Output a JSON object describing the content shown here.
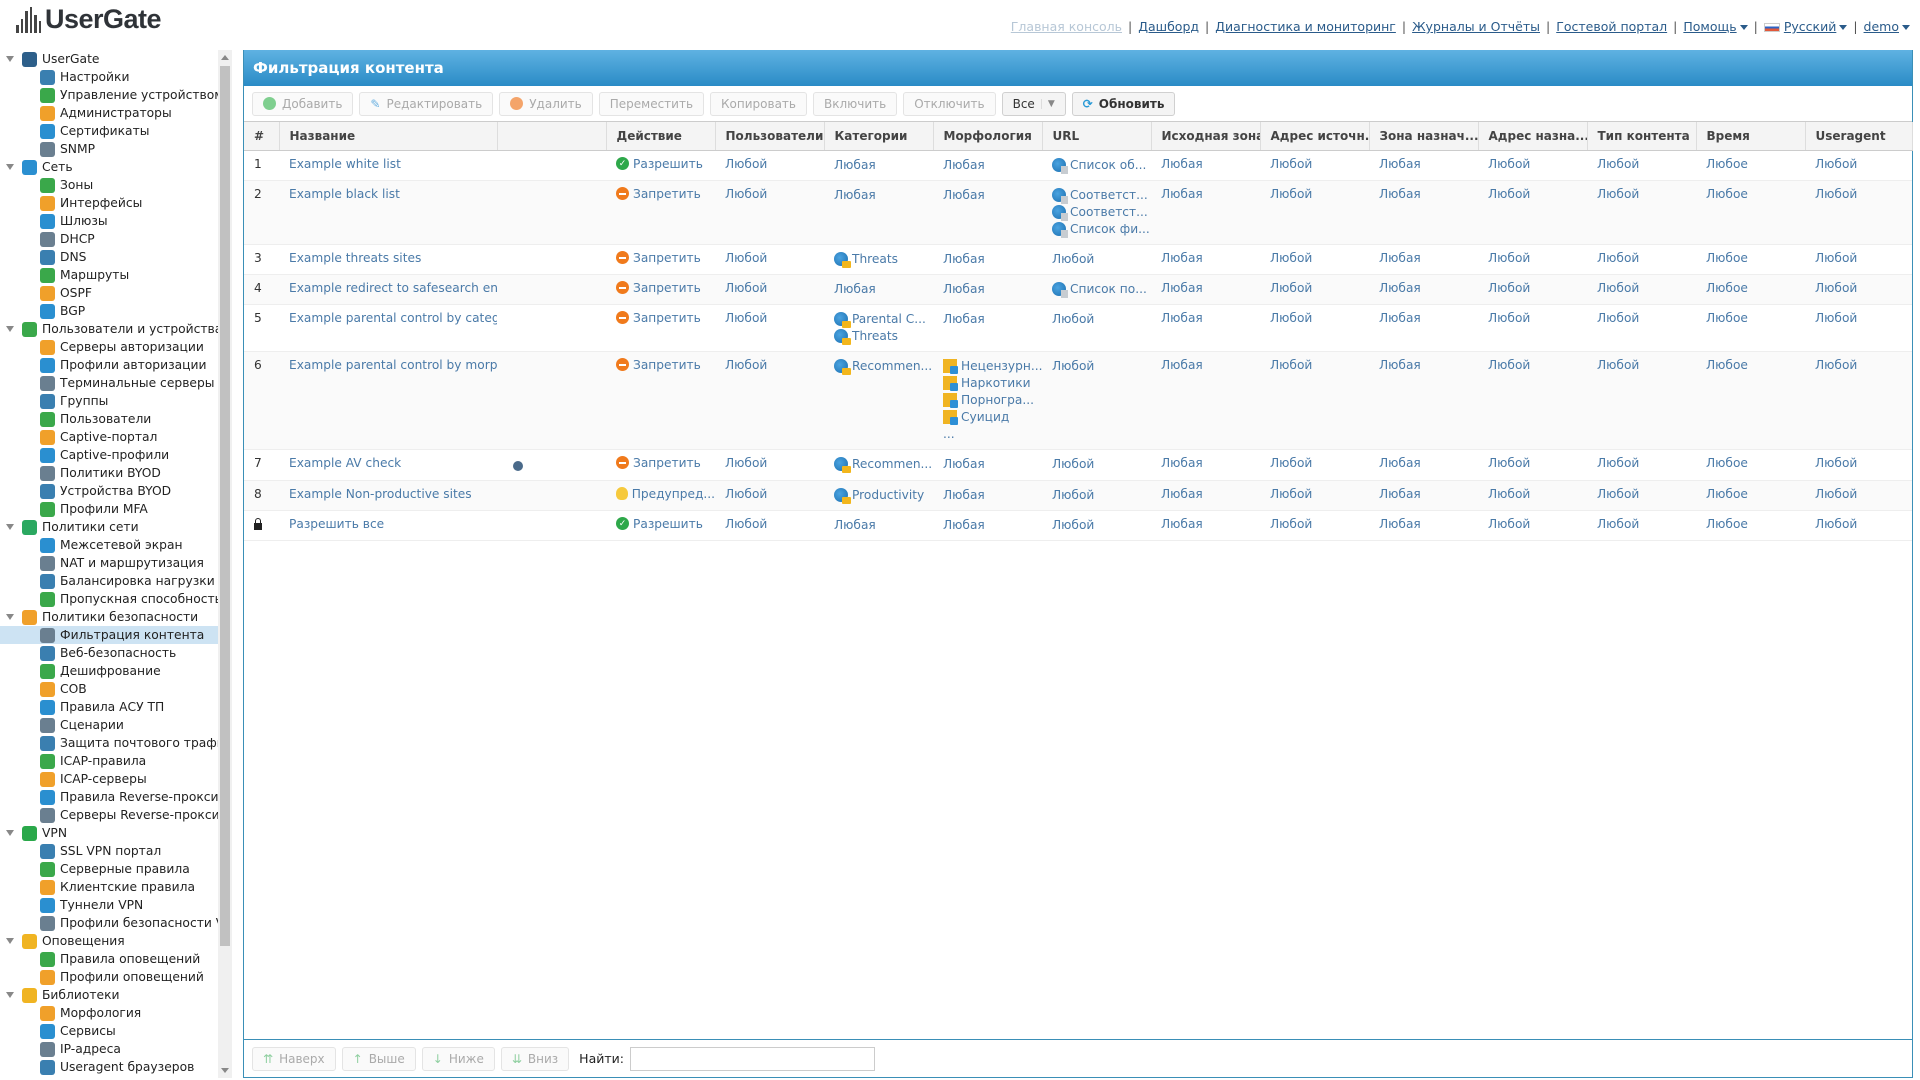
{
  "app": {
    "logo_text": "UserGate"
  },
  "top_nav": {
    "links": [
      {
        "label": "Главная консоль",
        "disabled": true
      },
      {
        "label": "Дашборд"
      },
      {
        "label": "Диагностика и мониторинг"
      },
      {
        "label": "Журналы и Отчёты"
      },
      {
        "label": "Гостевой портал"
      },
      {
        "label": "Помощь",
        "dropdown": true
      },
      {
        "label": "Русский",
        "dropdown": true,
        "flag": "ru"
      },
      {
        "label": "demo",
        "dropdown": true
      }
    ]
  },
  "sidebar": {
    "groups": [
      {
        "label": "UserGate",
        "icon": "usergate-icon",
        "items": [
          "Настройки",
          "Управление устройством",
          "Администраторы",
          "Сертификаты",
          "SNMP"
        ]
      },
      {
        "label": "Сеть",
        "icon": "network-icon",
        "items": [
          "Зоны",
          "Интерфейсы",
          "Шлюзы",
          "DHCP",
          "DNS",
          "Маршруты",
          "OSPF",
          "BGP"
        ]
      },
      {
        "label": "Пользователи и устройства",
        "icon": "users-devices-icon",
        "items": [
          "Серверы авторизации",
          "Профили авторизации",
          "Терминальные серверы",
          "Группы",
          "Пользователи",
          "Captive-портал",
          "Captive-профили",
          "Политики BYOD",
          "Устройства BYOD",
          "Профили MFA"
        ]
      },
      {
        "label": "Политики сети",
        "icon": "network-policies-icon",
        "items": [
          "Межсетевой экран",
          "NAT и маршрутизация",
          "Балансировка нагрузки",
          "Пропускная способность"
        ]
      },
      {
        "label": "Политики безопасности",
        "icon": "security-policies-icon",
        "items": [
          "Фильтрация контента",
          "Веб-безопасность",
          "Дешифрование",
          "СОВ",
          "Правила АСУ ТП",
          "Сценарии",
          "Защита почтового трафика",
          "ICAP-правила",
          "ICAP-серверы",
          "Правила Reverse-прокси",
          "Серверы Reverse-прокси"
        ]
      },
      {
        "label": "VPN",
        "icon": "vpn-icon",
        "items": [
          "SSL VPN портал",
          "Серверные правила",
          "Клиентские правила",
          "Туннели VPN",
          "Профили безопасности VPN"
        ]
      },
      {
        "label": "Оповещения",
        "icon": "notifications-icon",
        "items": [
          "Правила оповещений",
          "Профили оповещений"
        ]
      },
      {
        "label": "Библиотеки",
        "icon": "libraries-icon",
        "items": [
          "Морфология",
          "Сервисы",
          "IP-адреса",
          "Useragent браузеров"
        ]
      }
    ],
    "selected": "Фильтрация контента"
  },
  "panel": {
    "title": "Фильтрация контента",
    "toolbar": {
      "add": "Добавить",
      "edit": "Редактировать",
      "delete": "Удалить",
      "move": "Переместить",
      "copy": "Копировать",
      "enable": "Включить",
      "disable": "Отключить",
      "filter": "Все",
      "refresh": "Обновить"
    },
    "columns": [
      "#",
      "Название",
      "",
      "Действие",
      "Пользователи",
      "Категории",
      "Морфология",
      "URL",
      "Исходная зона",
      "Адрес источн...",
      "Зона назнач...",
      "Адрес назна...",
      "Тип контента",
      "Время",
      "Useragent"
    ],
    "rows": [
      {
        "num": "1",
        "name": "Example white list",
        "action": "Разрешить",
        "action_type": "allow",
        "users": "Любой",
        "categories": [
          {
            "text": "Любая",
            "icon": false
          }
        ],
        "morphology": [
          {
            "text": "Любая",
            "icon": false
          }
        ],
        "url": [
          {
            "text": "Список об...",
            "icon": true
          }
        ],
        "src_zone": "Любая",
        "src_addr": "Любой",
        "dst_zone": "Любая",
        "dst_addr": "Любой",
        "content_type": "Любой",
        "time": "Любое",
        "useragent": "Любой"
      },
      {
        "num": "2",
        "name": "Example black list",
        "action": "Запретить",
        "action_type": "deny",
        "users": "Любой",
        "categories": [
          {
            "text": "Любая",
            "icon": false
          }
        ],
        "morphology": [
          {
            "text": "Любая",
            "icon": false
          }
        ],
        "url": [
          {
            "text": "Соответст...",
            "icon": true
          },
          {
            "text": "Соответст...",
            "icon": true
          },
          {
            "text": "Список фи...",
            "icon": true
          }
        ],
        "src_zone": "Любая",
        "src_addr": "Любой",
        "dst_zone": "Любая",
        "dst_addr": "Любой",
        "content_type": "Любой",
        "time": "Любое",
        "useragent": "Любой"
      },
      {
        "num": "3",
        "name": "Example threats sites",
        "action": "Запретить",
        "action_type": "deny",
        "users": "Любой",
        "categories": [
          {
            "text": "Threats",
            "icon": true
          }
        ],
        "morphology": [
          {
            "text": "Любая",
            "icon": false
          }
        ],
        "url": [
          {
            "text": "Любой",
            "icon": false
          }
        ],
        "src_zone": "Любая",
        "src_addr": "Любой",
        "dst_zone": "Любая",
        "dst_addr": "Любой",
        "content_type": "Любой",
        "time": "Любое",
        "useragent": "Любой"
      },
      {
        "num": "4",
        "name": "Example redirect to safesearch eng...",
        "action": "Запретить",
        "action_type": "deny",
        "users": "Любой",
        "categories": [
          {
            "text": "Любая",
            "icon": false
          }
        ],
        "morphology": [
          {
            "text": "Любая",
            "icon": false
          }
        ],
        "url": [
          {
            "text": "Список по...",
            "icon": true
          }
        ],
        "src_zone": "Любая",
        "src_addr": "Любой",
        "dst_zone": "Любая",
        "dst_addr": "Любой",
        "content_type": "Любой",
        "time": "Любое",
        "useragent": "Любой"
      },
      {
        "num": "5",
        "name": "Example parental control by catego...",
        "action": "Запретить",
        "action_type": "deny",
        "users": "Любой",
        "categories": [
          {
            "text": "Parental C...",
            "icon": true
          },
          {
            "text": "Threats",
            "icon": true
          }
        ],
        "morphology": [
          {
            "text": "Любая",
            "icon": false
          }
        ],
        "url": [
          {
            "text": "Любой",
            "icon": false
          }
        ],
        "src_zone": "Любая",
        "src_addr": "Любой",
        "dst_zone": "Любая",
        "dst_addr": "Любой",
        "content_type": "Любой",
        "time": "Любое",
        "useragent": "Любой"
      },
      {
        "num": "6",
        "name": "Example parental control by morph...",
        "action": "Запретить",
        "action_type": "deny",
        "users": "Любой",
        "categories": [
          {
            "text": "Recommen...",
            "icon": true
          }
        ],
        "morphology": [
          {
            "text": "Нецензурн...",
            "icon": true
          },
          {
            "text": "Наркотики",
            "icon": true
          },
          {
            "text": "Порногра...",
            "icon": true
          },
          {
            "text": "Суицид",
            "icon": true
          },
          {
            "text": "...",
            "icon": false
          }
        ],
        "url": [
          {
            "text": "Любой",
            "icon": false
          }
        ],
        "src_zone": "Любая",
        "src_addr": "Любой",
        "dst_zone": "Любая",
        "dst_addr": "Любой",
        "content_type": "Любой",
        "time": "Любое",
        "useragent": "Любой"
      },
      {
        "num": "7",
        "name": "Example AV check",
        "extra_icon": "antivirus-icon",
        "action": "Запретить",
        "action_type": "deny",
        "users": "Любой",
        "categories": [
          {
            "text": "Recommen...",
            "icon": true
          }
        ],
        "morphology": [
          {
            "text": "Любая",
            "icon": false
          }
        ],
        "url": [
          {
            "text": "Любой",
            "icon": false
          }
        ],
        "src_zone": "Любая",
        "src_addr": "Любой",
        "dst_zone": "Любая",
        "dst_addr": "Любой",
        "content_type": "Любой",
        "time": "Любое",
        "useragent": "Любой"
      },
      {
        "num": "8",
        "name": "Example Non-productive sites",
        "action": "Предупред...",
        "action_type": "warn",
        "users": "Любой",
        "categories": [
          {
            "text": "Productivity",
            "icon": true
          }
        ],
        "morphology": [
          {
            "text": "Любая",
            "icon": false
          }
        ],
        "url": [
          {
            "text": "Любой",
            "icon": false
          }
        ],
        "src_zone": "Любая",
        "src_addr": "Любой",
        "dst_zone": "Любая",
        "dst_addr": "Любой",
        "content_type": "Любой",
        "time": "Любое",
        "useragent": "Любой"
      },
      {
        "num": "",
        "locked": true,
        "name": "Разрешить все",
        "action": "Разрешить",
        "action_type": "allow",
        "users": "Любой",
        "categories": [
          {
            "text": "Любая",
            "icon": false
          }
        ],
        "morphology": [
          {
            "text": "Любая",
            "icon": false
          }
        ],
        "url": [
          {
            "text": "Любой",
            "icon": false
          }
        ],
        "src_zone": "Любая",
        "src_addr": "Любой",
        "dst_zone": "Любая",
        "dst_addr": "Любой",
        "content_type": "Любой",
        "time": "Любое",
        "useragent": "Любой"
      }
    ],
    "bottom": {
      "top": "Наверх",
      "up": "Выше",
      "down": "Ниже",
      "bottom": "Вниз",
      "search_label": "Найти:",
      "search_value": ""
    }
  },
  "colors": {
    "header_blue": "#2a8bc6",
    "link": "#4a7aa8",
    "allow": "#2ea84a",
    "deny": "#f07a1c",
    "warn": "#f6c93c",
    "selected": "#cde3f3"
  }
}
